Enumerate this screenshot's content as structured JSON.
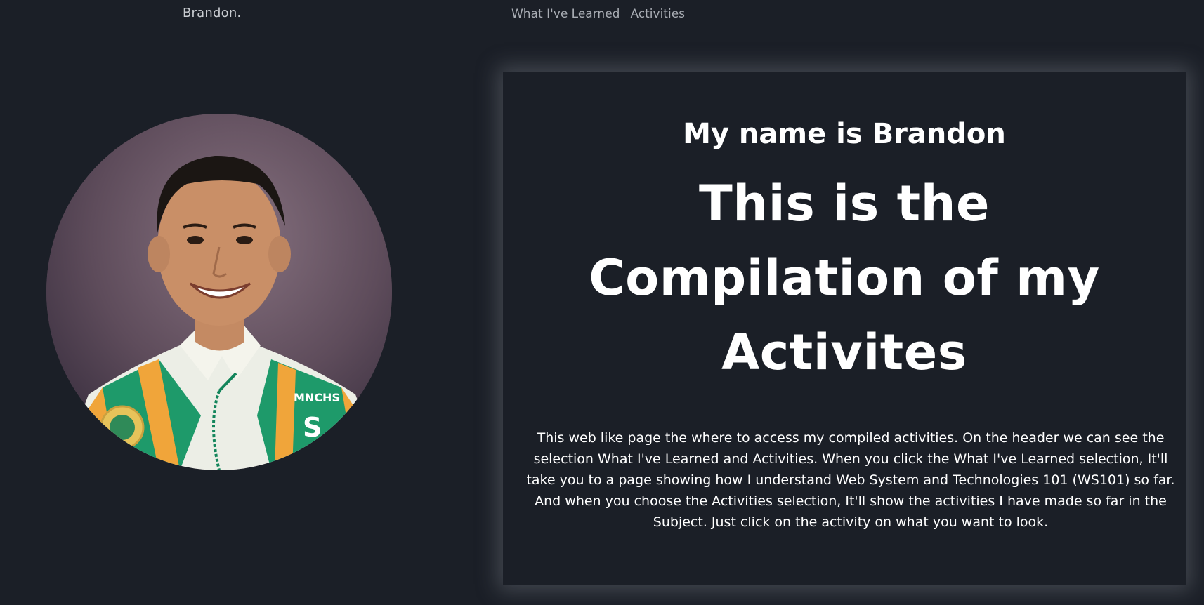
{
  "header": {
    "brand": "Brandon.",
    "nav": [
      {
        "label": "What I've Learned"
      },
      {
        "label": "Activities"
      }
    ]
  },
  "hero": {
    "subtitle": "My name is Brandon",
    "headline": "This is the Compilation of my Activites",
    "description": "This web like page the where to access my compiled activities. On the header we can see the selection What I've Learned and Activities. When you click the What I've Learned selection, It'll take you to a page showing how I understand Web System and Technologies 101 (WS101) so far. And when you choose the Activities selection, It'll show the activities I have made so far in the Subject. Just click on the activity on what you want to look."
  },
  "portrait": {
    "badge_text": "MNCHS",
    "badge_letter": "S"
  },
  "colors": {
    "background": "#1b1f27",
    "text": "#ffffff",
    "nav_text": "#a9adb4",
    "sash_green": "#1e9a6a",
    "sash_orange": "#f0a53a"
  }
}
